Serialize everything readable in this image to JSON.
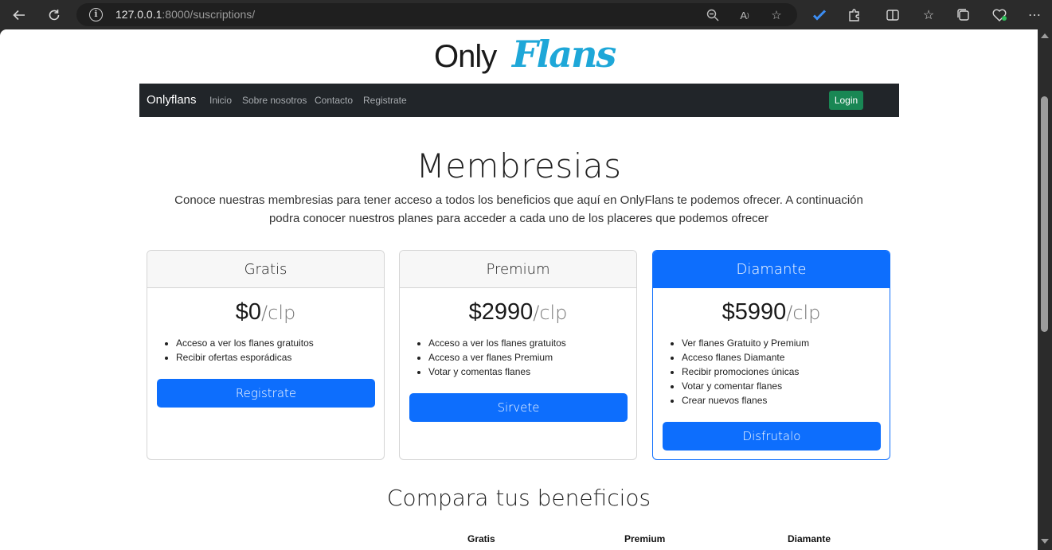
{
  "browser": {
    "url_host": "127.0.0.1",
    "url_rest": ":8000/suscriptions/"
  },
  "logo": {
    "part1": "Only",
    "part2": "Flans"
  },
  "navbar": {
    "brand": "Onlyflans",
    "links": [
      "Inicio",
      "Sobre nosotros",
      "Contacto",
      "Registrate"
    ],
    "login": "Login"
  },
  "page": {
    "title": "Membresias",
    "intro": "Conoce nuestras membresias para tener acceso a todos los beneficios que aquí en OnlyFlans te podemos ofrecer. A continuación podra conocer nuestros planes para acceder a cada uno de los placeres que podemos ofrecer",
    "compare_title": "Compara tus beneficios"
  },
  "plans": [
    {
      "name": "Gratis",
      "price": "$0",
      "unit": "/clp",
      "features": [
        "Acceso a ver los flanes gratuitos",
        "Recibir ofertas esporádicas"
      ],
      "button": "Registrate"
    },
    {
      "name": "Premium",
      "price": "$2990",
      "unit": "/clp",
      "features": [
        "Acceso a ver los flanes gratuitos",
        "Acceso a ver flanes Premium",
        "Votar y comentas flanes"
      ],
      "button": "Sirvete"
    },
    {
      "name": "Diamante",
      "price": "$5990",
      "unit": "/clp",
      "features": [
        "Ver flanes Gratuito y Premium",
        "Acceso flanes Diamante",
        "Recibir promociones únicas",
        "Votar y comentar flanes",
        "Crear nuevos flanes"
      ],
      "button": "Disfrutalo"
    }
  ],
  "compare_table": {
    "headers": [
      "Gratis",
      "Premium",
      "Diamante"
    ]
  },
  "colors": {
    "primary": "#0d6efd",
    "success": "#198754",
    "navbar": "#212529",
    "logo_accent": "#1ea7d8"
  }
}
